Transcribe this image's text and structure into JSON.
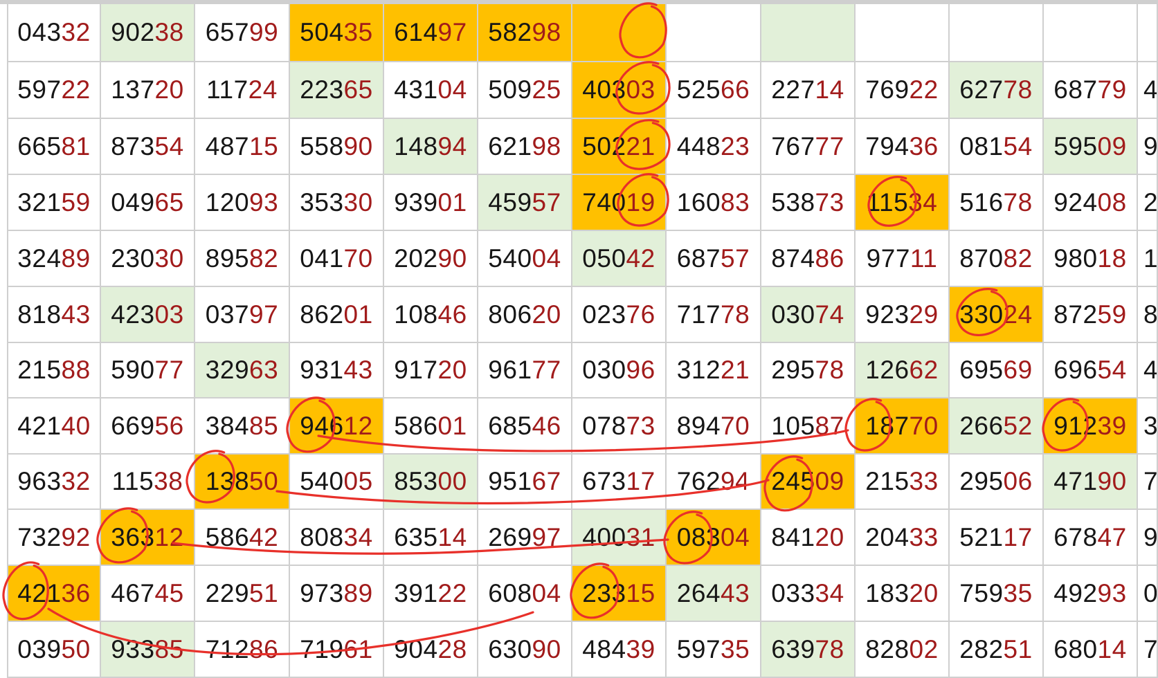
{
  "rows": [
    [
      {
        "v": "04332"
      },
      {
        "v": "90238",
        "bg": "green"
      },
      {
        "v": "65799"
      },
      {
        "v": "50435",
        "bg": "orange"
      },
      {
        "v": "61497",
        "bg": "orange"
      },
      {
        "v": "58298",
        "bg": "orange"
      },
      {
        "v": "",
        "bg": "orange"
      },
      {
        "v": ""
      },
      {
        "v": "",
        "bg": "green"
      },
      {
        "v": ""
      },
      {
        "v": ""
      },
      {
        "v": ""
      },
      {
        "v": ""
      }
    ],
    [
      {
        "v": "59722"
      },
      {
        "v": "13720"
      },
      {
        "v": "11724"
      },
      {
        "v": "22365",
        "bg": "green"
      },
      {
        "v": "43104"
      },
      {
        "v": "50925"
      },
      {
        "v": "40303",
        "bg": "orange"
      },
      {
        "v": "52566"
      },
      {
        "v": "22714"
      },
      {
        "v": "76922"
      },
      {
        "v": "62778",
        "bg": "green"
      },
      {
        "v": "68779"
      },
      {
        "v": "4"
      }
    ],
    [
      {
        "v": "66581"
      },
      {
        "v": "87354"
      },
      {
        "v": "48715"
      },
      {
        "v": "55890"
      },
      {
        "v": "14894",
        "bg": "green"
      },
      {
        "v": "62198"
      },
      {
        "v": "50221",
        "bg": "orange"
      },
      {
        "v": "44823"
      },
      {
        "v": "76777"
      },
      {
        "v": "79436"
      },
      {
        "v": "08154"
      },
      {
        "v": "59509",
        "bg": "green"
      },
      {
        "v": "9"
      }
    ],
    [
      {
        "v": "32159"
      },
      {
        "v": "04965"
      },
      {
        "v": "12093"
      },
      {
        "v": "35330"
      },
      {
        "v": "93901"
      },
      {
        "v": "45957",
        "bg": "green"
      },
      {
        "v": "74019",
        "bg": "orange"
      },
      {
        "v": "16083"
      },
      {
        "v": "53873"
      },
      {
        "v": "11534",
        "bg": "orange"
      },
      {
        "v": "51678"
      },
      {
        "v": "92408"
      },
      {
        "v": "2"
      }
    ],
    [
      {
        "v": "32489"
      },
      {
        "v": "23030"
      },
      {
        "v": "89582"
      },
      {
        "v": "04170"
      },
      {
        "v": "20290"
      },
      {
        "v": "54004"
      },
      {
        "v": "05042",
        "bg": "green"
      },
      {
        "v": "68757"
      },
      {
        "v": "87486"
      },
      {
        "v": "97711"
      },
      {
        "v": "87082"
      },
      {
        "v": "98018"
      },
      {
        "v": "1"
      }
    ],
    [
      {
        "v": "81843"
      },
      {
        "v": "42303",
        "bg": "green"
      },
      {
        "v": "03797"
      },
      {
        "v": "86201"
      },
      {
        "v": "10846"
      },
      {
        "v": "80620"
      },
      {
        "v": "02376"
      },
      {
        "v": "71778"
      },
      {
        "v": "03074",
        "bg": "green"
      },
      {
        "v": "92329"
      },
      {
        "v": "33024",
        "bg": "orange"
      },
      {
        "v": "87259"
      },
      {
        "v": "8"
      }
    ],
    [
      {
        "v": "21588"
      },
      {
        "v": "59077"
      },
      {
        "v": "32963",
        "bg": "green"
      },
      {
        "v": "93143"
      },
      {
        "v": "91720"
      },
      {
        "v": "96177"
      },
      {
        "v": "03096"
      },
      {
        "v": "31221"
      },
      {
        "v": "29578"
      },
      {
        "v": "12662",
        "bg": "green"
      },
      {
        "v": "69569"
      },
      {
        "v": "69654"
      },
      {
        "v": "4"
      }
    ],
    [
      {
        "v": "42140"
      },
      {
        "v": "66956"
      },
      {
        "v": "38485"
      },
      {
        "v": "94612",
        "bg": "orange"
      },
      {
        "v": "58601"
      },
      {
        "v": "68546"
      },
      {
        "v": "07873"
      },
      {
        "v": "89470"
      },
      {
        "v": "10587"
      },
      {
        "v": "18770",
        "bg": "orange"
      },
      {
        "v": "26652",
        "bg": "green"
      },
      {
        "v": "91239",
        "bg": "orange"
      },
      {
        "v": "3"
      }
    ],
    [
      {
        "v": "96332"
      },
      {
        "v": "11538"
      },
      {
        "v": "13850",
        "bg": "orange"
      },
      {
        "v": "54005"
      },
      {
        "v": "85300",
        "bg": "green"
      },
      {
        "v": "95167"
      },
      {
        "v": "67317"
      },
      {
        "v": "76294"
      },
      {
        "v": "24509",
        "bg": "orange"
      },
      {
        "v": "21533"
      },
      {
        "v": "29506"
      },
      {
        "v": "47190",
        "bg": "green"
      },
      {
        "v": "7"
      }
    ],
    [
      {
        "v": "73292"
      },
      {
        "v": "36312",
        "bg": "orange"
      },
      {
        "v": "58642"
      },
      {
        "v": "80834"
      },
      {
        "v": "63514"
      },
      {
        "v": "26997"
      },
      {
        "v": "40031",
        "bg": "green"
      },
      {
        "v": "08304",
        "bg": "orange"
      },
      {
        "v": "84120"
      },
      {
        "v": "20433"
      },
      {
        "v": "52117"
      },
      {
        "v": "67847"
      },
      {
        "v": "9"
      }
    ],
    [
      {
        "v": "42136",
        "bg": "orange"
      },
      {
        "v": "46745"
      },
      {
        "v": "22951"
      },
      {
        "v": "97389"
      },
      {
        "v": "39122"
      },
      {
        "v": "60804"
      },
      {
        "v": "23315",
        "bg": "orange"
      },
      {
        "v": "26443",
        "bg": "green"
      },
      {
        "v": "03334"
      },
      {
        "v": "18320"
      },
      {
        "v": "75935"
      },
      {
        "v": "49293"
      },
      {
        "v": "0"
      }
    ],
    [
      {
        "v": "03950"
      },
      {
        "v": "93385",
        "bg": "green"
      },
      {
        "v": "71286"
      },
      {
        "v": "71961"
      },
      {
        "v": "90428"
      },
      {
        "v": "63090"
      },
      {
        "v": "48439"
      },
      {
        "v": "59735"
      },
      {
        "v": "63978",
        "bg": "green"
      },
      {
        "v": "82802"
      },
      {
        "v": "28251"
      },
      {
        "v": "68014"
      },
      {
        "v": "7"
      }
    ]
  ],
  "colors": {
    "green": "#e2f0d9",
    "orange": "#ffc000",
    "digits": "#161616",
    "tail_digits": "#a11b1b",
    "ink": "#e8302a"
  },
  "annotations": {
    "circle_marks": 17,
    "connecting_strokes": 4
  }
}
